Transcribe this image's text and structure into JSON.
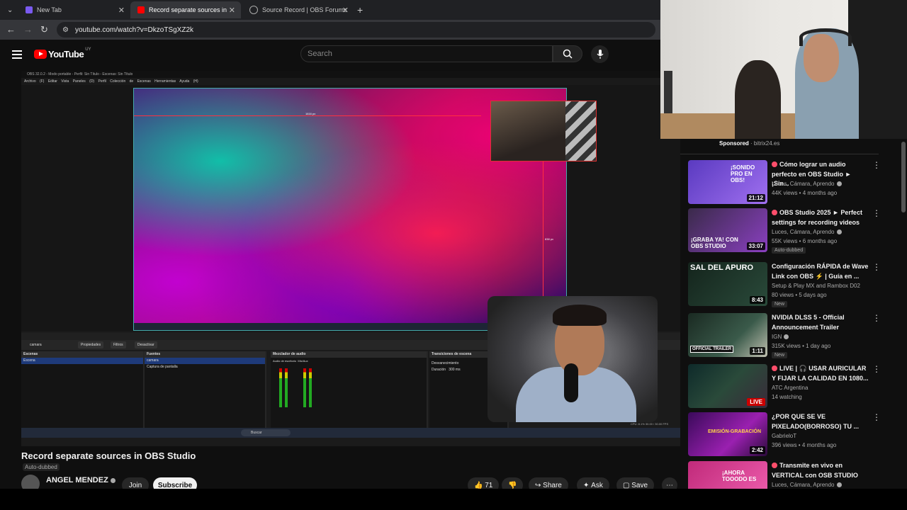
{
  "browser": {
    "tabs": [
      {
        "label": "New Tab"
      },
      {
        "label": "Record separate sources in OBS"
      },
      {
        "label": "Source Record | OBS Forums"
      }
    ],
    "url": "youtube.com/watch?v=DkzoTSgXZ2k"
  },
  "youtube": {
    "logo_text": "YouTube",
    "country_code": "UY",
    "search_placeholder": "Search"
  },
  "player": {
    "obs_window_title": "OBS 32.0.2 - Modo portable - Perfil: Sin Título - Escenas: Sin Título",
    "obs_menu": "Archivo (F)  Editar  Vista  Paneles (D)  Perfil  Colección de Escenas  Herramientas  Ayuda (H)",
    "measure_w": "1616 px",
    "measure_h": "838 px",
    "dock_toolbar": {
      "source": "camara",
      "properties": "Propiedades",
      "filters": "Filtros",
      "deactivate": "Desactivar"
    },
    "panels": {
      "scenes": {
        "header": "Escenas",
        "items": [
          "Escena"
        ]
      },
      "sources": {
        "header": "Fuentes",
        "items": [
          "camara",
          "Captura de pantalla"
        ]
      },
      "mixer": {
        "header": "Mezclador de audio",
        "ch1": "Audio de escritorio",
        "ch2": "Mic/Aux"
      },
      "transitions": {
        "header": "Transiciones de escena",
        "type": "Desvanecimiento",
        "duration_label": "Duración",
        "duration": "300 ms"
      }
    },
    "stats": "CPU: 8.1%   30.00 / 30.00 FPS",
    "search_taskbar": "Buscar"
  },
  "video": {
    "title": "Record separate sources in OBS Studio",
    "auto_dubbed": "Auto-dubbed",
    "channel": "ANGEL MENDEZ",
    "join": "Join",
    "subscribe": "Subscribe",
    "likes": "71",
    "share": "Share",
    "ask": "Ask",
    "save": "Save"
  },
  "sidebar": {
    "sponsored_label": "Sponsored",
    "sponsored_domain": "bitrix24.es",
    "recommendations": [
      {
        "title": "Cómo lograr un audio perfecto en OBS Studio ► ¡Sin...",
        "channel": "Luces, Cámara, Aprendo",
        "meta": "44K views • 4 months ago",
        "duration": "21:12",
        "thumb_text": "¡SONIDO PRO EN OBS!",
        "color": "#6a4ad0"
      },
      {
        "title": "OBS Studio 2025 ► Perfect settings for recording videos",
        "channel": "Luces, Cámara, Aprendo",
        "meta": "55K views • 6 months ago",
        "duration": "33:07",
        "badge": "Auto-dubbed",
        "thumb_text": "¡GRABA YA! CON OBS STUDIO",
        "color": "#7a3ab0"
      },
      {
        "title": "Configuración RÁPIDA de Wave Link con OBS ⚡ | Guía en ...",
        "channel": "Setup & Play MX and Rambox D02",
        "meta": "80 views • 5 days ago",
        "duration": "8:43",
        "badge": "New",
        "thumb_text": "SAL DEL APURO",
        "color": "#1f3a2a"
      },
      {
        "title": "NVIDIA DLSS 5 - Official Announcement Trailer",
        "channel": "IGN",
        "meta": "315K views • 1 day ago",
        "duration": "1:11",
        "badge": "New",
        "thumb_text": "OFFICIAL TRAILER",
        "color": "#2a3a30"
      },
      {
        "title": "LIVE | 🎧 USAR AURICULAR Y FIJAR LA CALIDAD EN 1080...",
        "channel": "ATC Argentina",
        "meta": "14 watching",
        "live": "LIVE",
        "thumb_text": "",
        "color": "#1a3a3a"
      },
      {
        "title": "¿POR QUE SE VE PIXELADO(BORROSO) TU ...",
        "channel": "GabrieloT",
        "meta": "396 views • 4 months ago",
        "duration": "2:42",
        "thumb_text": "EMISIÓN-GRABACIÓN",
        "color": "#6a1a8a"
      },
      {
        "title": "Transmite en vivo en VERTICAL con OSB STUDIO",
        "channel": "Luces, Cámara, Aprendo",
        "meta": "",
        "thumb_text": "¡AHORA TOOODO ES",
        "color": "#d0308a"
      }
    ]
  }
}
